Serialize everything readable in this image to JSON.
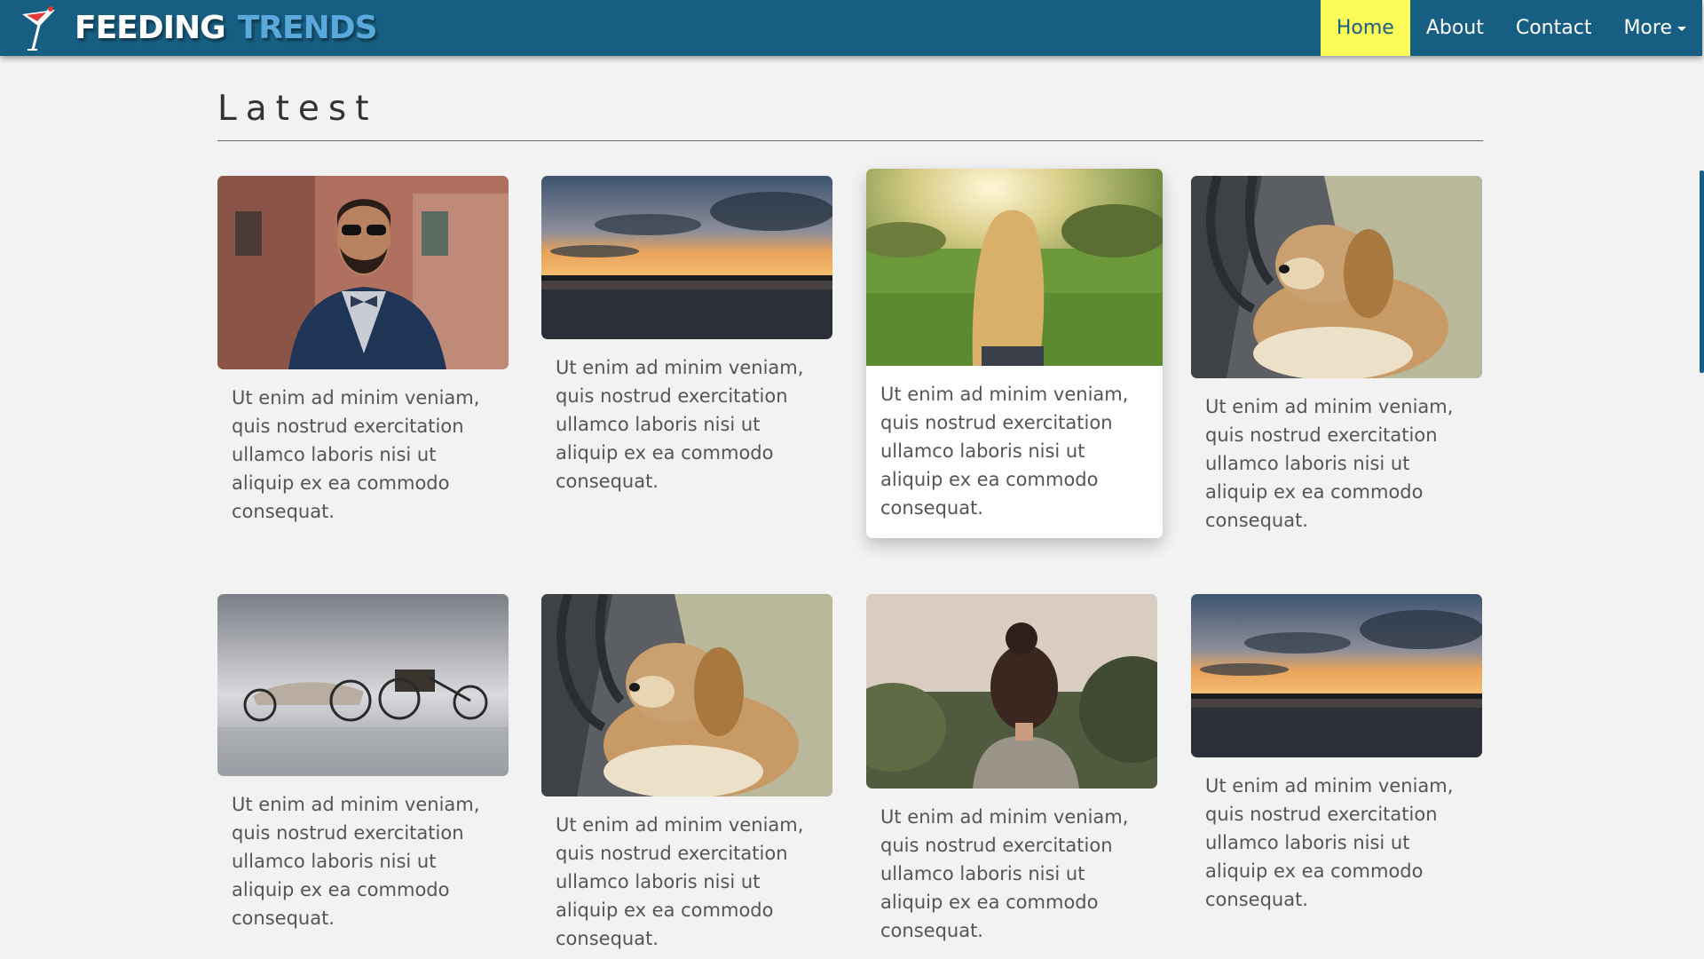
{
  "brand": {
    "word1": "FEEDING",
    "word2": "TRENDS",
    "logo_icon": "cocktail-glass-icon"
  },
  "nav": {
    "items": [
      {
        "label": "Home",
        "active": true
      },
      {
        "label": "About",
        "active": false
      },
      {
        "label": "Contact",
        "active": false
      },
      {
        "label": "More",
        "active": false,
        "has_dropdown": true
      }
    ]
  },
  "section": {
    "title": "Latest"
  },
  "cards": [
    {
      "image": "man-with-sunglasses-photo",
      "text": "Ut enim ad minim veniam, quis nostrud exercitation ullamco laboris nisi ut aliquip ex ea commodo consequat."
    },
    {
      "image": "sunset-lake-photo",
      "text": "Ut enim ad minim veniam, quis nostrud exercitation ullamco laboris nisi ut aliquip ex ea commodo consequat."
    },
    {
      "image": "girl-in-field-photo",
      "text": "Ut enim ad minim veniam, quis nostrud exercitation ullamco laboris nisi ut aliquip ex ea commodo consequat."
    },
    {
      "image": "dog-photo",
      "text": "Ut enim ad minim veniam, quis nostrud exercitation ullamco laboris nisi ut aliquip ex ea commodo consequat."
    },
    {
      "image": "vintage-cars-photo",
      "text": "Ut enim ad minim veniam, quis nostrud exercitation ullamco laboris nisi ut aliquip ex ea commodo consequat."
    },
    {
      "image": "dog-photo",
      "text": "Ut enim ad minim veniam, quis nostrud exercitation ullamco laboris nisi ut aliquip ex ea commodo consequat."
    },
    {
      "image": "woman-back-photo",
      "text": "Ut enim ad minim veniam, quis nostrud exercitation ullamco laboris nisi ut aliquip ex ea commodo consequat."
    },
    {
      "image": "sunset-lake-photo",
      "text": "Ut enim ad minim veniam, quis nostrud exercitation ullamco laboris nisi ut aliquip ex ea commodo consequat."
    }
  ],
  "colors": {
    "navbar": "#175f82",
    "active_nav": "#fbfb5a",
    "brand_accent": "#5aa9dd",
    "page_bg": "#f2f2f2"
  }
}
